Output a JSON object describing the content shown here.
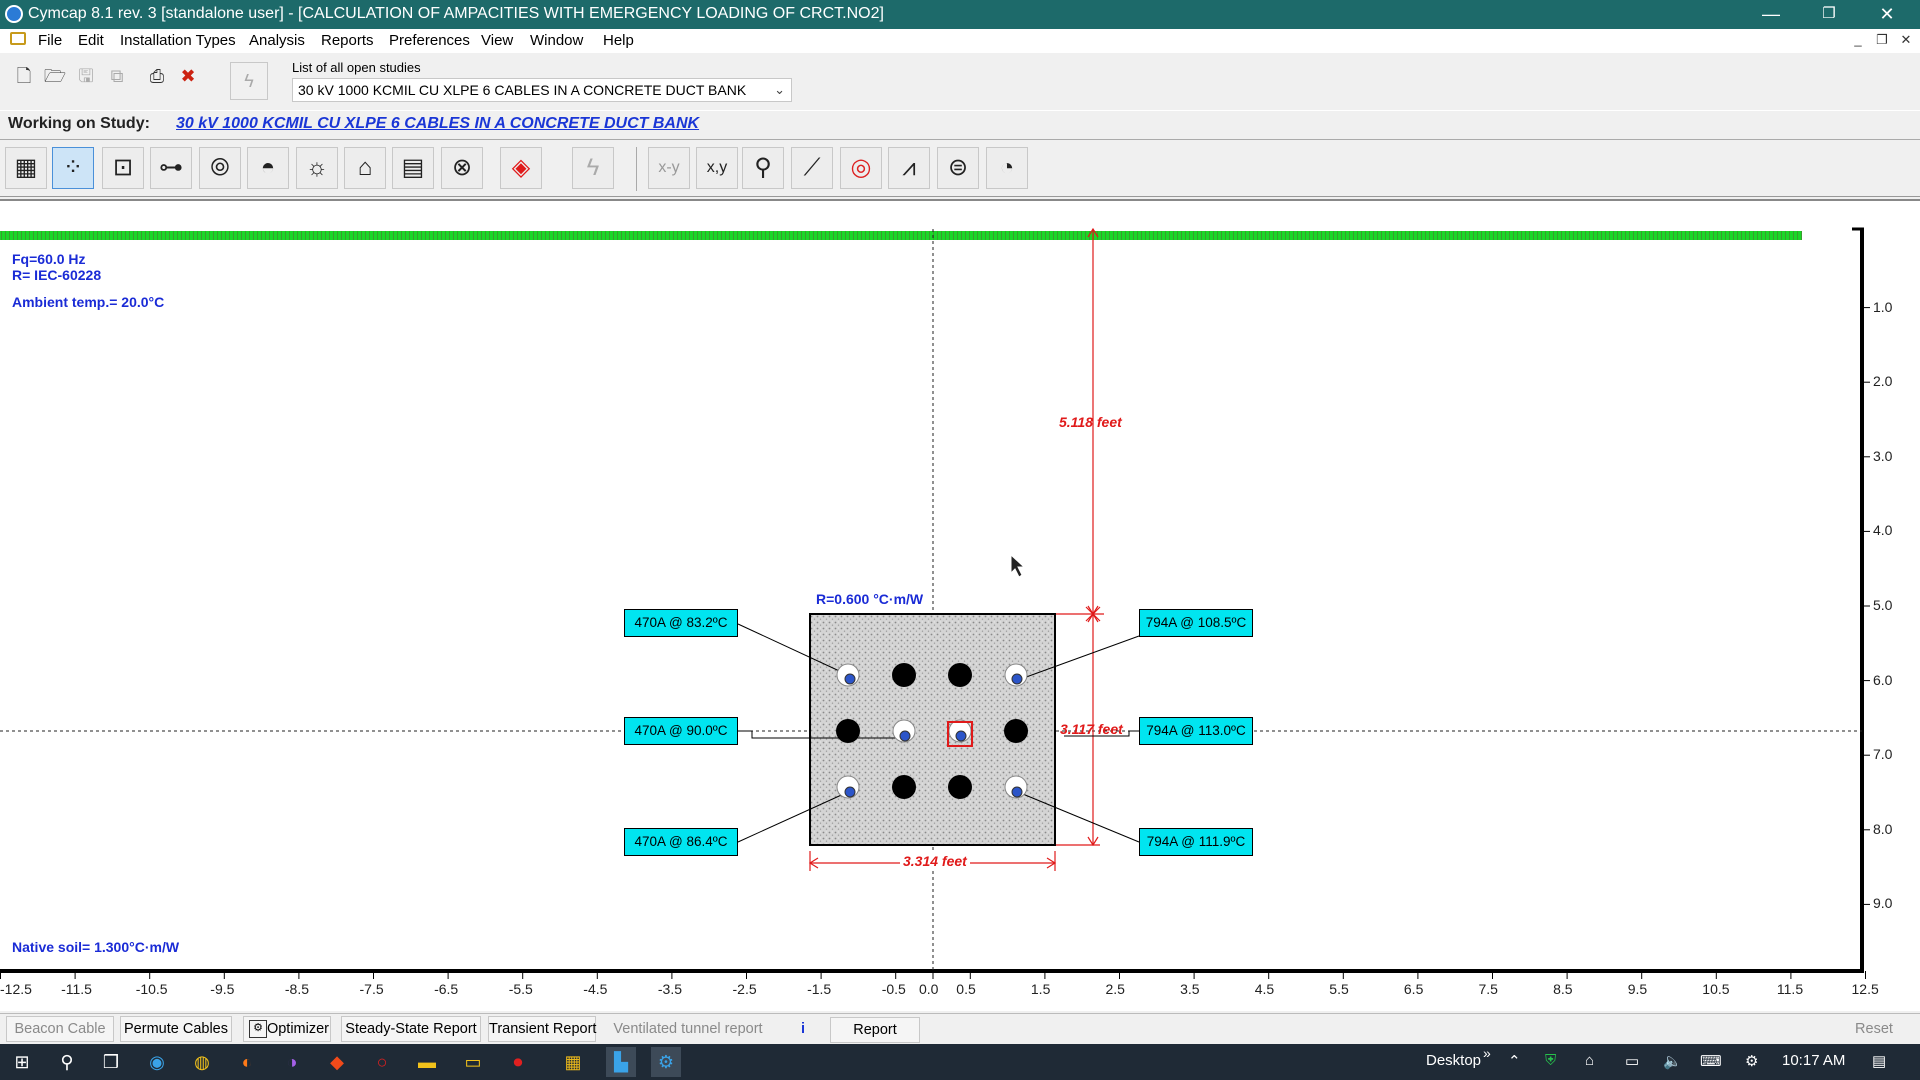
{
  "window": {
    "title": "Cymcap 8.1 rev. 3 [standalone user] - [CALCULATION OF AMPACITIES WITH EMERGENCY LOADING OF CRCT.NO2]",
    "controls": {
      "minimize": "—",
      "restore": "❐",
      "close": "✕"
    }
  },
  "menu": {
    "items": [
      "File",
      "Edit",
      "Installation Types",
      "Analysis",
      "Reports",
      "Preferences",
      "View",
      "Window",
      "Help"
    ],
    "mdi_controls": {
      "minimize": "_",
      "restore": "❐",
      "close": "✕"
    }
  },
  "toolbar": {
    "studies_label": "List of all open studies",
    "selected_study": "30 kV 1000 KCMIL CU XLPE 6 CABLES IN A CONCRETE DUCT BANK"
  },
  "working": {
    "label": "Working on Study:",
    "study": "30 kV 1000 KCMIL CU XLPE 6 CABLES IN A CONCRETE DUCT BANK"
  },
  "canvas": {
    "frequency": "Fq=60.0 Hz",
    "rating_method": "R= IEC-60228",
    "ambient": "Ambient temp.= 20.0°C",
    "native_soil": "Native soil= 1.300°C·m/W",
    "duct_bank_resistivity": "R=0.600 °C·m/W",
    "dim_depth": "5.118 feet",
    "dim_height": "3.117 feet",
    "dim_width": "3.314 feet",
    "x_ticks": [
      "-12.5",
      "-11.5",
      "-10.5",
      "-9.5",
      "-8.5",
      "-7.5",
      "-6.5",
      "-5.5",
      "-4.5",
      "-3.5",
      "-2.5",
      "-1.5",
      "-0.5",
      "0.0",
      "0.5",
      "1.5",
      "2.5",
      "3.5",
      "4.5",
      "5.5",
      "6.5",
      "7.5",
      "8.5",
      "9.5",
      "10.5",
      "11.5",
      "12.5"
    ],
    "y_ticks": [
      "1.0",
      "2.0",
      "3.0",
      "4.0",
      "5.0",
      "6.0",
      "7.0",
      "8.0",
      "9.0"
    ],
    "cable_labels": {
      "left_top": "470A @ 83.2ºC",
      "left_mid": "470A @ 90.0ºC",
      "left_bot": "470A @ 86.4ºC",
      "right_top": "794A @ 108.5ºC",
      "right_mid": "794A @ 113.0ºC",
      "right_bot": "794A @ 111.9ºC"
    }
  },
  "bottom_buttons": {
    "beacon": "Beacon Cable",
    "permute": "Permute Cables",
    "optimizer": "Optimizer",
    "steady": "Steady-State Report",
    "transient": "Transient Report",
    "ventilated": "Ventilated tunnel report",
    "info": "i",
    "report": "Report",
    "reset": "Reset"
  },
  "taskbar": {
    "desktop": "Desktop",
    "time": "10:17 AM"
  },
  "colors": {
    "titlebar": "#1d6a6a",
    "label_fill": "#00e5f0",
    "dimension_red": "#e01a1a",
    "info_blue": "#1a2bd6",
    "ground_green": "#1bd628"
  }
}
